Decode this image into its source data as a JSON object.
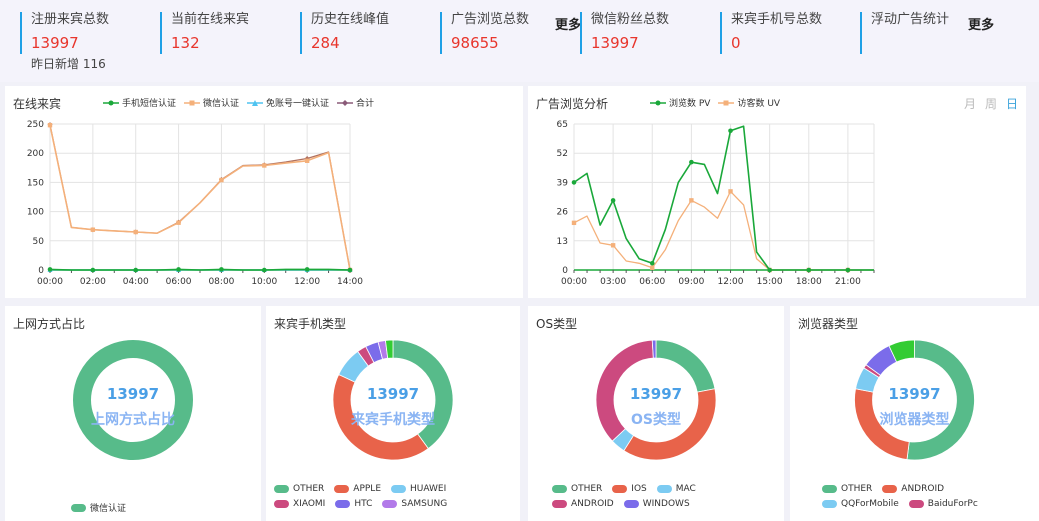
{
  "stats": [
    {
      "label": "注册来宾总数",
      "value": "13997",
      "sub": "昨日新增 116"
    },
    {
      "label": "当前在线来宾",
      "value": "132"
    },
    {
      "label": "历史在线峰值",
      "value": "284"
    },
    {
      "label": "广告浏览总数",
      "value": "98655"
    },
    {
      "label": "微信粉丝总数",
      "value": "13997"
    },
    {
      "label": "来宾手机号总数",
      "value": "0"
    },
    {
      "label": "浮动广告统计",
      "value": ""
    }
  ],
  "more_label": "更多",
  "online": {
    "title": "在线来宾",
    "legend": [
      {
        "name": "手机短信认证",
        "color": "#1aa83a",
        "marker": "circle"
      },
      {
        "name": "微信认证",
        "color": "#f4b07a",
        "marker": "square"
      },
      {
        "name": "免账号一键认证",
        "color": "#4fc3f0",
        "marker": "triangle"
      },
      {
        "name": "合计",
        "color": "#8a5a78",
        "marker": "diamond"
      }
    ]
  },
  "ads": {
    "title": "广告浏览分析",
    "legend": [
      {
        "name": "浏览数 PV",
        "color": "#1aa83a",
        "marker": "circle"
      },
      {
        "name": "访客数 UV",
        "color": "#f4b07a",
        "marker": "square"
      }
    ],
    "tabs": [
      "月",
      "周",
      "日"
    ],
    "active_tab": "日"
  },
  "chart_data": [
    {
      "type": "line",
      "yticks": [
        "0",
        "50",
        "100",
        "150",
        "200",
        "250"
      ],
      "xticks": [
        "00:00",
        "02:00",
        "04:00",
        "06:00",
        "08:00",
        "10:00",
        "12:00",
        "14:00"
      ],
      "ylim": [
        0,
        250
      ],
      "x": [
        0,
        1,
        2,
        3,
        4,
        5,
        6,
        7,
        8,
        9,
        10,
        11,
        12,
        13,
        14
      ],
      "series": [
        {
          "name": "手机短信认证",
          "values": [
            1,
            0,
            0,
            0,
            0,
            0,
            1,
            0,
            1,
            0,
            0,
            1,
            1,
            1,
            0
          ]
        },
        {
          "name": "微信认证",
          "values": [
            248,
            73,
            69,
            67,
            65,
            63,
            81,
            115,
            154,
            178,
            179,
            183,
            187,
            201,
            0
          ]
        },
        {
          "name": "免账号一键认证",
          "values": [
            0,
            0,
            0,
            0,
            0,
            0,
            0,
            0,
            0,
            0,
            0,
            0,
            0,
            0,
            0
          ]
        },
        {
          "name": "合计",
          "values": [
            249,
            73,
            69,
            67,
            65,
            63,
            82,
            115,
            155,
            179,
            180,
            185,
            191,
            202,
            0
          ]
        }
      ],
      "marker_x": [
        0,
        2,
        4,
        6,
        8,
        10,
        12,
        14
      ]
    },
    {
      "type": "line",
      "yticks": [
        "0",
        "13",
        "26",
        "39",
        "52",
        "65"
      ],
      "xticks": [
        "00:00",
        "03:00",
        "06:00",
        "09:00",
        "12:00",
        "15:00",
        "18:00",
        "21:00"
      ],
      "ylim": [
        0,
        65
      ],
      "x": [
        0,
        1,
        2,
        3,
        4,
        5,
        6,
        7,
        8,
        9,
        10,
        11,
        12,
        13,
        14,
        15,
        16,
        17,
        18,
        19,
        20,
        21,
        22,
        23
      ],
      "series": [
        {
          "name": "浏览数 PV",
          "values": [
            39,
            43,
            20,
            31,
            14,
            5,
            3,
            18,
            39,
            48,
            47,
            34,
            62,
            64,
            8,
            0,
            0,
            0,
            0,
            0,
            0,
            0,
            0,
            0
          ]
        },
        {
          "name": "访客数 UV",
          "values": [
            21,
            24,
            12,
            11,
            4,
            3,
            1,
            9,
            22,
            31,
            28,
            23,
            35,
            29,
            5,
            0,
            0,
            0,
            0,
            0,
            0,
            0,
            0,
            0
          ]
        }
      ],
      "marker_x": [
        0,
        3,
        6,
        9,
        12,
        15,
        18,
        21
      ]
    }
  ],
  "donuts": [
    {
      "title": "上网方式占比",
      "center_value": "13997",
      "center_label": "上网方式占比",
      "slices": [
        {
          "name": "微信认证",
          "value": 100,
          "color": "#57bb8a"
        }
      ]
    },
    {
      "title": "来宾手机类型",
      "center_value": "13997",
      "center_label": "来宾手机类型",
      "slices": [
        {
          "name": "OTHER",
          "value": 40,
          "color": "#57bb8a"
        },
        {
          "name": "APPLE",
          "value": 42,
          "color": "#e8634a"
        },
        {
          "name": "HUAWEI",
          "value": 8,
          "color": "#7ccbf2"
        },
        {
          "name": "XIAOMI",
          "value": 2.5,
          "color": "#cc4a7f"
        },
        {
          "name": "HTC",
          "value": 3.5,
          "color": "#7b6cea"
        },
        {
          "name": "SAMSUNG",
          "value": 2,
          "color": "#b27ae9"
        },
        {
          "name": "",
          "value": 2,
          "color": "#33cc33"
        }
      ]
    },
    {
      "title": "OS类型",
      "center_value": "13997",
      "center_label": "OS类型",
      "slices": [
        {
          "name": "OTHER",
          "value": 22,
          "color": "#57bb8a"
        },
        {
          "name": "IOS",
          "value": 37,
          "color": "#e8634a"
        },
        {
          "name": "MAC",
          "value": 4,
          "color": "#7ccbf2"
        },
        {
          "name": "ANDROID",
          "value": 36,
          "color": "#cc4a7f"
        },
        {
          "name": "WINDOWS",
          "value": 1,
          "color": "#7b6cea"
        }
      ]
    },
    {
      "title": "浏览器类型",
      "center_value": "13997",
      "center_label": "浏览器类型",
      "slices": [
        {
          "name": "OTHER",
          "value": 52,
          "color": "#57bb8a"
        },
        {
          "name": "ANDROID",
          "value": 26,
          "color": "#e8634a"
        },
        {
          "name": "QQForMobile",
          "value": 6,
          "color": "#7ccbf2"
        },
        {
          "name": "BaiduForPc",
          "value": 1,
          "color": "#cc4a7f"
        },
        {
          "name": "",
          "value": 8,
          "color": "#7b6cea"
        },
        {
          "name": "",
          "value": 7,
          "color": "#33cc33"
        }
      ]
    }
  ]
}
